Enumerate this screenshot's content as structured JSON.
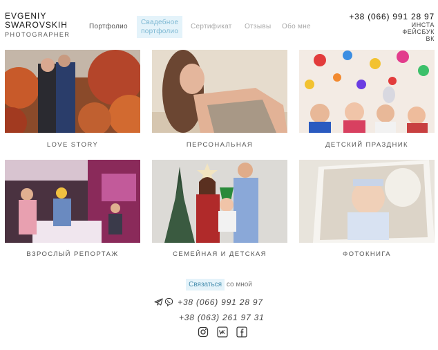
{
  "logo": {
    "line1": "EVGENIY",
    "line2": "SWAROVSKIH",
    "line3": "PHOTOGRAPHER"
  },
  "nav": [
    {
      "label": "Портфолио"
    },
    {
      "label_line1": "Свадебное",
      "label_line2": "портфолио"
    },
    {
      "label": "Сертификат"
    },
    {
      "label": "Отзывы"
    },
    {
      "label": "Обо мне"
    }
  ],
  "header_contacts": {
    "phone": "+38 (066) 991 28 97",
    "links": [
      "ИНСТА",
      "ФЕЙСБУК",
      "ВК"
    ]
  },
  "gallery": [
    {
      "caption": "LOVE STORY",
      "image": "couple-autumn-photo"
    },
    {
      "caption": "ПЕРСОНАЛЬНАЯ",
      "image": "portrait-woman-photo"
    },
    {
      "caption": "ДЕТСКИЙ ПРАЗДНИК",
      "image": "kids-party-photo"
    },
    {
      "caption": "ВЗРОСЛЫЙ РЕПОРТАЖ",
      "image": "party-reportage-photo"
    },
    {
      "caption": "СЕМЕЙНАЯ И ДЕТСКАЯ",
      "image": "family-photo"
    },
    {
      "caption": "ФОТОКНИГА",
      "image": "photobook-photo"
    }
  ],
  "footer": {
    "cta_button": "Связаться",
    "cta_rest": " со мной",
    "phone1": "+38 (066) 991 28 97",
    "phone2": "+38 (063) 261 97 31",
    "messenger_icons": [
      "telegram-icon",
      "viber-icon"
    ],
    "social_icons": [
      "instagram-icon",
      "vk-icon",
      "facebook-icon"
    ]
  },
  "colors": {
    "accent_bg": "#e4f3fa",
    "accent_text": "#4a90b0",
    "muted_text": "#a8a8a8"
  }
}
